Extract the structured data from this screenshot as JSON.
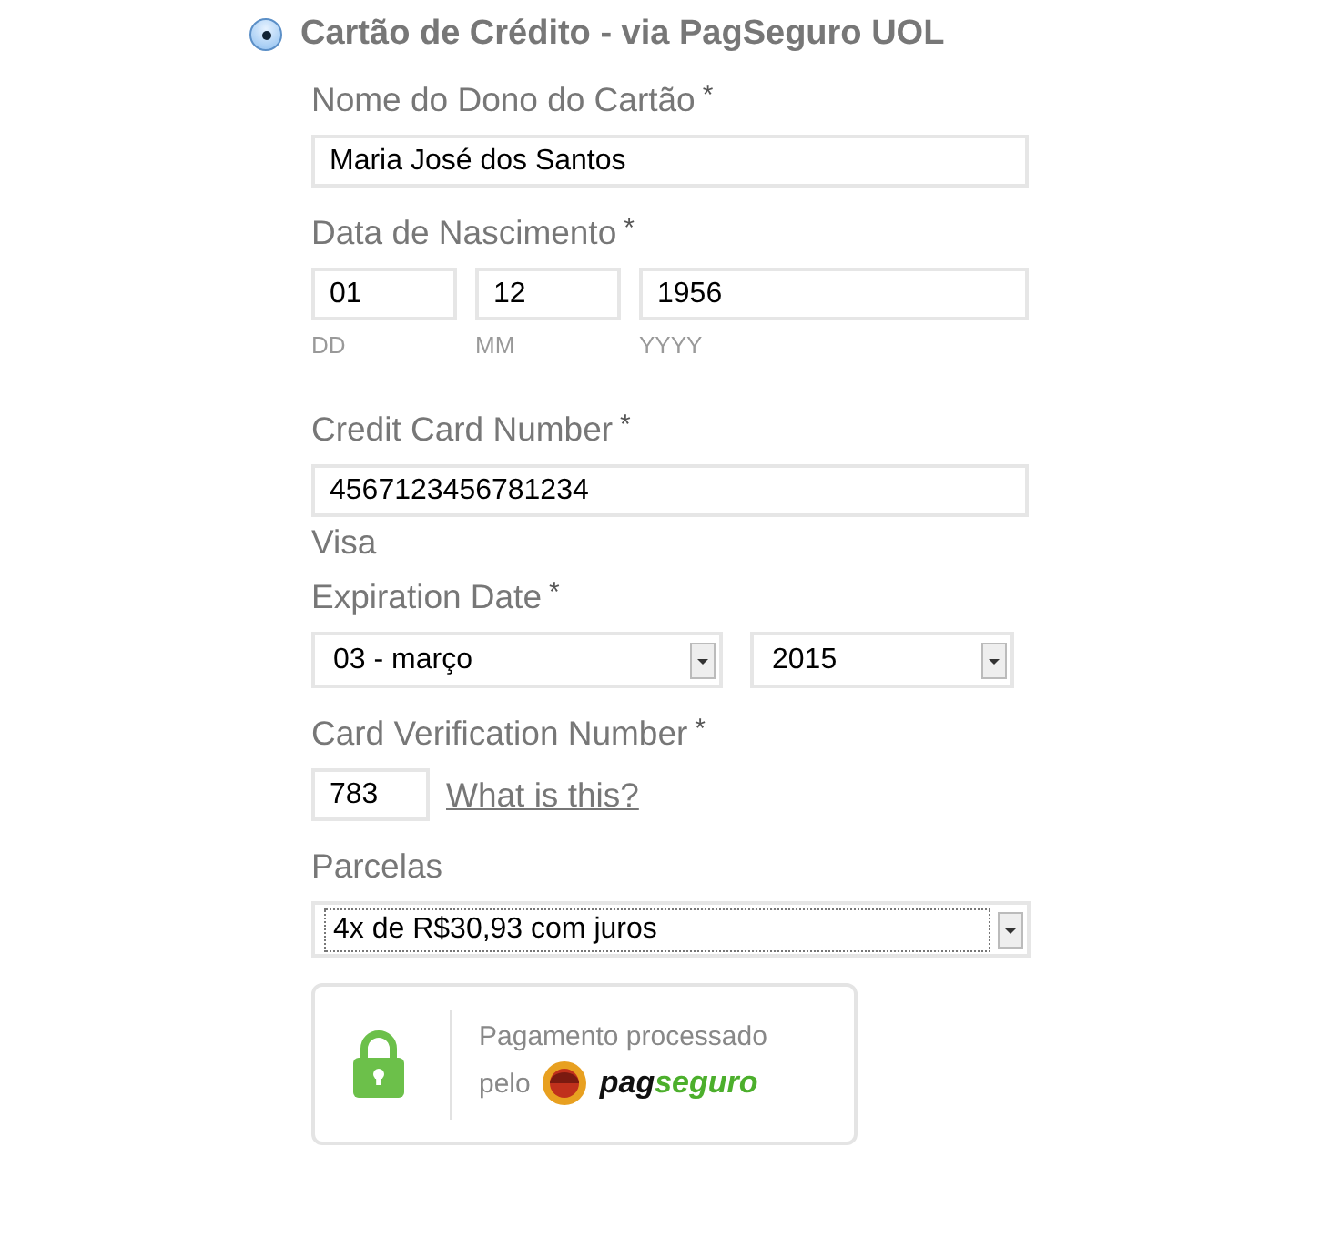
{
  "payment_option": {
    "label": "Cartão de Crédito - via PagSeguro UOL",
    "selected": true
  },
  "fields": [
    {
      "kind": "text",
      "label": "Nome do Dono do Cartão",
      "required_mark": "*",
      "value": "Maria José dos Santos"
    },
    {
      "kind": "date",
      "label": "Data de Nascimento",
      "required_mark": "*",
      "parts": [
        {
          "value": "01",
          "hint": "DD"
        },
        {
          "value": "12",
          "hint": "MM"
        },
        {
          "value": "1956",
          "hint": "YYYY"
        }
      ]
    },
    {
      "kind": "text",
      "label": "Credit Card Number",
      "required_mark": "*",
      "value": "4567123456781234",
      "note": "Visa"
    },
    {
      "kind": "selects",
      "label": "Expiration Date",
      "required_mark": "*",
      "options": [
        "03 - março",
        "2015"
      ]
    },
    {
      "kind": "cvv",
      "label": "Card Verification Number",
      "required_mark": "*",
      "value": "783",
      "link": "What is this?"
    },
    {
      "kind": "select",
      "label": "Parcelas",
      "value": "4x de R$30,93 com juros"
    }
  ],
  "badge": {
    "line_1": "Pagamento processado",
    "line_2": "pelo",
    "logo_dark": "pag",
    "logo_green": "seguro"
  }
}
